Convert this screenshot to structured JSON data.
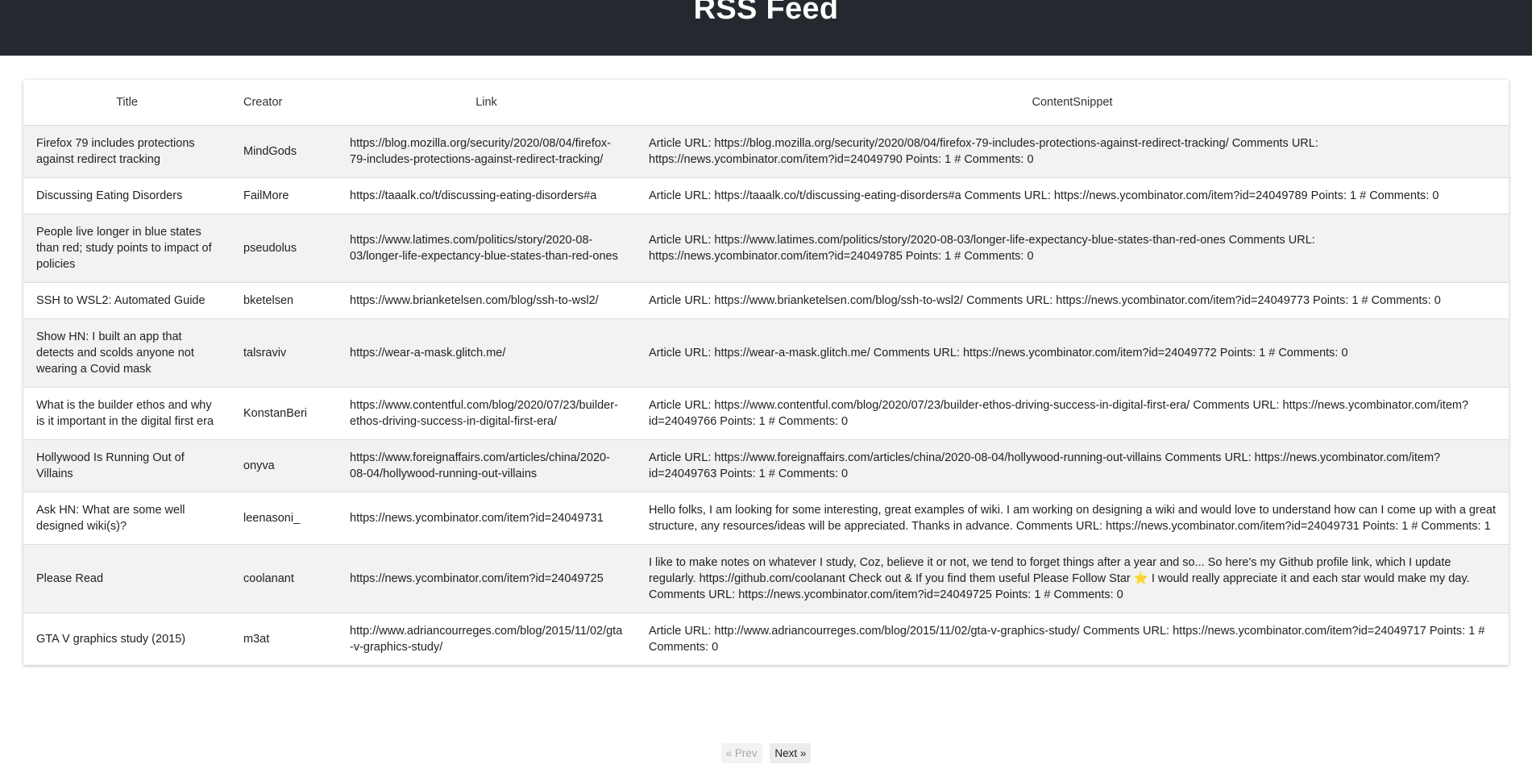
{
  "header": {
    "title": "RSS Feed"
  },
  "table": {
    "columns": [
      "Title",
      "Creator",
      "Link",
      "ContentSnippet"
    ],
    "rows": [
      {
        "title": "Firefox 79 includes protections against redirect tracking",
        "creator": "MindGods",
        "link": "https://blog.mozilla.org/security/2020/08/04/firefox-79-includes-protections-against-redirect-tracking/",
        "snippet": "Article URL: https://blog.mozilla.org/security/2020/08/04/firefox-79-includes-protections-against-redirect-tracking/ Comments URL: https://news.ycombinator.com/item?id=24049790 Points: 1 # Comments: 0"
      },
      {
        "title": "Discussing Eating Disorders",
        "creator": "FailMore",
        "link": "https://taaalk.co/t/discussing-eating-disorders#a",
        "snippet": "Article URL: https://taaalk.co/t/discussing-eating-disorders#a Comments URL: https://news.ycombinator.com/item?id=24049789 Points: 1 # Comments: 0"
      },
      {
        "title": "People live longer in blue states than red; study points to impact of policies",
        "creator": "pseudolus",
        "link": "https://www.latimes.com/politics/story/2020-08-03/longer-life-expectancy-blue-states-than-red-ones",
        "snippet": "Article URL: https://www.latimes.com/politics/story/2020-08-03/longer-life-expectancy-blue-states-than-red-ones Comments URL: https://news.ycombinator.com/item?id=24049785 Points: 1 # Comments: 0"
      },
      {
        "title": "SSH to WSL2: Automated Guide",
        "creator": "bketelsen",
        "link": "https://www.brianketelsen.com/blog/ssh-to-wsl2/",
        "snippet": "Article URL: https://www.brianketelsen.com/blog/ssh-to-wsl2/ Comments URL: https://news.ycombinator.com/item?id=24049773 Points: 1 # Comments: 0"
      },
      {
        "title": "Show HN: I built an app that detects and scolds anyone not wearing a Covid mask",
        "creator": "talsraviv",
        "link": "https://wear-a-mask.glitch.me/",
        "snippet": "Article URL: https://wear-a-mask.glitch.me/ Comments URL: https://news.ycombinator.com/item?id=24049772 Points: 1 # Comments: 0"
      },
      {
        "title": "What is the builder ethos and why is it important in the digital first era",
        "creator": "KonstanBeri",
        "link": "https://www.contentful.com/blog/2020/07/23/builder-ethos-driving-success-in-digital-first-era/",
        "snippet": "Article URL: https://www.contentful.com/blog/2020/07/23/builder-ethos-driving-success-in-digital-first-era/ Comments URL: https://news.ycombinator.com/item?id=24049766 Points: 1 # Comments: 0"
      },
      {
        "title": "Hollywood Is Running Out of Villains",
        "creator": "onyva",
        "link": "https://www.foreignaffairs.com/articles/china/2020-08-04/hollywood-running-out-villains",
        "snippet": "Article URL: https://www.foreignaffairs.com/articles/china/2020-08-04/hollywood-running-out-villains Comments URL: https://news.ycombinator.com/item?id=24049763 Points: 1 # Comments: 0"
      },
      {
        "title": "Ask HN: What are some well designed wiki(s)?",
        "creator": "leenasoni_",
        "link": "https://news.ycombinator.com/item?id=24049731",
        "snippet": "Hello folks, I am looking for some interesting, great examples of wiki. I am working on designing a wiki and would love to understand how can I come up with a great structure, any resources/ideas will be appreciated. Thanks in advance. Comments URL: https://news.ycombinator.com/item?id=24049731 Points: 1 # Comments: 1"
      },
      {
        "title": "Please Read",
        "creator": "coolanant",
        "link": "https://news.ycombinator.com/item?id=24049725",
        "snippet": "I like to make notes on whatever I study, Coz, believe it or not, we tend to forget things after a year and so... So here's my Github profile link, which I update regularly. https://github.com/coolanant Check out & If you find them useful Please Follow Star ⭐ I would really appreciate it and each star would make my day. Comments URL: https://news.ycombinator.com/item?id=24049725 Points: 1 # Comments: 0"
      },
      {
        "title": "GTA V graphics study (2015)",
        "creator": "m3at",
        "link": "http://www.adriancourreges.com/blog/2015/11/02/gta-v-graphics-study/",
        "snippet": "Article URL: http://www.adriancourreges.com/blog/2015/11/02/gta-v-graphics-study/ Comments URL: https://news.ycombinator.com/item?id=24049717 Points: 1 # Comments: 0"
      }
    ]
  },
  "pagination": {
    "prev_label": "« Prev",
    "next_label": "Next »"
  }
}
